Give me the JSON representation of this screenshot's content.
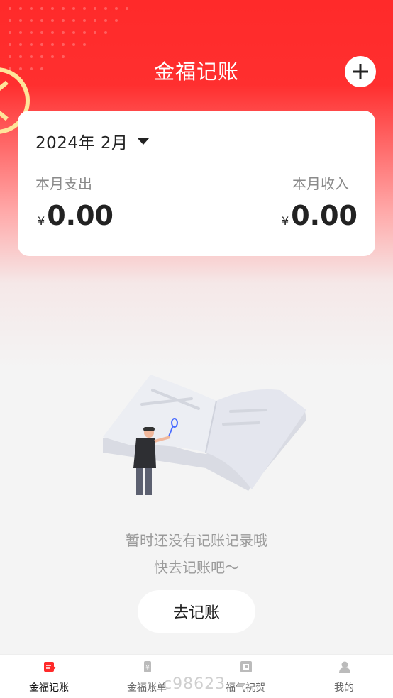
{
  "header": {
    "title": "金福记账"
  },
  "summary": {
    "month": "2024年 2月",
    "expense_label": "本月支出",
    "income_label": "本月收入",
    "currency": "¥",
    "expense_value": "0.00",
    "income_value": "0.00"
  },
  "empty_state": {
    "line1": "暂时还没有记账记录哦",
    "line2": "快去记账吧～",
    "button": "去记账"
  },
  "tabbar": {
    "items": [
      {
        "label": "金福记账",
        "icon": "bookkeeping-icon",
        "active": true
      },
      {
        "label": "金福账单",
        "icon": "bill-icon",
        "active": false
      },
      {
        "label": "福气祝贺",
        "icon": "blessing-icon",
        "active": false
      },
      {
        "label": "我的",
        "icon": "profile-icon",
        "active": false
      }
    ]
  },
  "watermark": "c98623",
  "colors": {
    "brand": "#ff2a2a",
    "active_tab": "#ff2a2a",
    "inactive_tab": "#bbbbbb"
  }
}
